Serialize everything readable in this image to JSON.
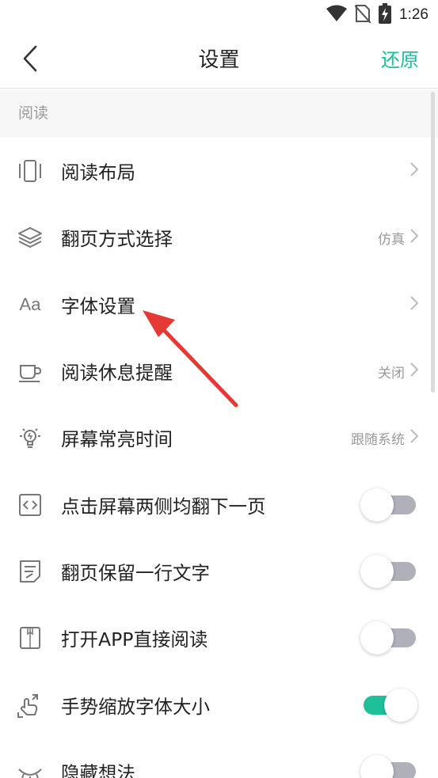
{
  "status_bar": {
    "time": "1:26",
    "icons": [
      "wifi-icon",
      "no-sim-icon",
      "battery-charging-icon"
    ]
  },
  "header": {
    "title": "设置",
    "back_icon": "chevron-left-icon",
    "restore_label": "还原"
  },
  "colors": {
    "accent": "#1fbf9a",
    "annotation_arrow": "#e53935"
  },
  "section": {
    "title": "阅读"
  },
  "rows": [
    {
      "label": "阅读布局",
      "icon": "layout-icon",
      "value": "",
      "control": "chevron"
    },
    {
      "label": "翻页方式选择",
      "icon": "layers-icon",
      "value": "仿真",
      "control": "chevron"
    },
    {
      "label": "字体设置",
      "icon": "font-icon",
      "icon_text": "Aa",
      "value": "",
      "control": "chevron"
    },
    {
      "label": "阅读休息提醒",
      "icon": "cup-icon",
      "value": "关闭",
      "control": "chevron"
    },
    {
      "label": "屏幕常亮时间",
      "icon": "lightbulb-icon",
      "value": "跟随系统",
      "control": "chevron"
    },
    {
      "label": "点击屏幕两侧均翻下一页",
      "icon": "code-icon",
      "control": "toggle",
      "on": false
    },
    {
      "label": "翻页保留一行文字",
      "icon": "note-icon",
      "control": "toggle",
      "on": false
    },
    {
      "label": "打开APP直接阅读",
      "icon": "book-icon",
      "control": "toggle",
      "on": false
    },
    {
      "label": "手势缩放字体大小",
      "icon": "gesture-icon",
      "control": "toggle",
      "on": true
    },
    {
      "label": "隐藏想法",
      "icon": "eye-closed-icon",
      "control": "toggle",
      "on": false
    }
  ]
}
